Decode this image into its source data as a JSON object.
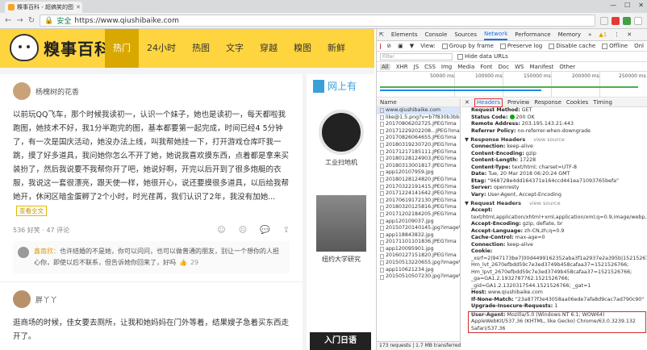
{
  "browser": {
    "tab_title": "糗事百科 - 超搞笑的图",
    "url": "https://www.qiushibaike.com",
    "secure_label": "安全"
  },
  "site": {
    "logo_text": "糗事百科",
    "menu": [
      "热门",
      "24小时",
      "热图",
      "文字",
      "穿越",
      "糗图",
      "新鲜"
    ],
    "posts": [
      {
        "author": "杨槐树的花香",
        "content": "以前玩QQ飞车，那个时候我读初一，认识一个妹子，她也是读初一，每天都啦我跑图，她技术不好，我1分半跑完的图，基本都要第一起完成，时间已经4 5分钟了，有一次是国庆活动，她没办法上线，叫我帮她挂一下，打开游戏仓库吓我一跳，摸了好多道具，我问她你怎么不开了她，她说我喜欢摸东西，点着都是拿来买装扮了，然后我说要不我帮你开了吧，她说好啊，开完以后开到了很多炮艇的衣服，我说这一套很漂亮，跟天使一样，她很开心，说还要摸很多道具，以后给我帮她开，休闲区暗金蛋孵了2个小时，时光荏苒，我们认识了2年，我没有加她...",
        "more_label": "查看全文",
        "stats": "536 好笑 · 47 评论",
        "comment_name": "鑫南欣：",
        "comment_text": "也许结婚的不是她，你可以问问，也可以做普通的朋友，别让一个想你的人担心你，即使以后不联系，但告诉她你回来了，好吗",
        "comment_likes": "29"
      },
      {
        "author": "胖丫丫",
        "content": "逛商场的时候，佳女要去厕所，让我和她妈妈在门外等着，结果嫂子急着买东西走开了。"
      }
    ],
    "sidebar": {
      "title": "网上有",
      "items": [
        "工业扫地机",
        "纽约大学研究"
      ],
      "banner": "入门日语"
    }
  },
  "devtools": {
    "tabs": [
      "Elements",
      "Console",
      "Sources",
      "Network",
      "Performance",
      "Memory"
    ],
    "active_tab": "Network",
    "toolbar": [
      "View:",
      "Group by frame",
      "Preserve log",
      "Disable cache",
      "Offline",
      "Onl"
    ],
    "filter_placeholder": "Filter",
    "hide_data_urls": "Hide data URLs",
    "types": [
      "All",
      "XHR",
      "JS",
      "CSS",
      "Img",
      "Media",
      "Font",
      "Doc",
      "WS",
      "Manifest",
      "Other"
    ],
    "timeline_labels": [
      "50000 ms",
      "100000 ms",
      "150000 ms",
      "200000 ms",
      "250000 ms"
    ],
    "requests_header": "Name",
    "requests": [
      "www.qiushibaike.com",
      "like@1.5.png?v=b7f830b3bb9",
      "20170806202725.JPEG?ima",
      "20171229202208...JPEG?ima",
      "20170826064655.JPEG?ima",
      "20180319230720.JPEG?ima",
      "20171217185111.JPEG?ima",
      "20180128124903.JPEG?ima",
      "20180313001817.JPEG?ima",
      "app120107959.jpg",
      "20180128124820.JPEG?ima",
      "20170322191415.JPEG?ima",
      "20171224141642.JPEG?ima",
      "20170619172130.JPEG?ima",
      "20180320125816.JPEG?ima",
      "20171202184205.JPEG?ima",
      "app120109037.jpg",
      "20150720140145.jpg?imageVi",
      "app118843832.jpg",
      "20171101101836.JPEG?ima",
      "app120095901.jpg",
      "20160127151820.JPEG?ima",
      "20150513220655.jpg?imageVi",
      "app110621234.jpg",
      "20150510507230.jpg?imageVi"
    ],
    "status_bar": "173 requests | 1.7 MB transferred",
    "detail_tabs": [
      "Headers",
      "Preview",
      "Response",
      "Cookies",
      "Timing"
    ],
    "general": [
      [
        "Request Method:",
        "GET"
      ],
      [
        "Status Code:",
        "200 OK"
      ],
      [
        "Remote Address:",
        "203.195.143.21:443"
      ],
      [
        "Referrer Policy:",
        "no-referrer-when-downgrade"
      ]
    ],
    "response_headers_title": "Response Headers",
    "view_source": "view source",
    "response_headers": [
      [
        "Connection:",
        "keep-alive"
      ],
      [
        "Content-Encoding:",
        "gzip"
      ],
      [
        "Content-Length:",
        "17228"
      ],
      [
        "Content-Type:",
        "text/html; charset=UTF-8"
      ],
      [
        "Date:",
        "Tue, 20 Mar 2018 06:20:24 GMT"
      ],
      [
        "Etag:",
        "\"968728e4dd164371e164ccd441ea71093765befa\""
      ],
      [
        "Server:",
        "openresty"
      ],
      [
        "Vary:",
        "User-Agent, Accept-Encoding"
      ]
    ],
    "request_headers_title": "Request Headers",
    "request_headers": [
      [
        "Accept:",
        "text/html,application/xhtml+xml,application/xml;q=0.9,image/webp,image/apng,*/*;q=0.8"
      ],
      [
        "Accept-Encoding:",
        "gzip, deflate, br"
      ],
      [
        "Accept-Language:",
        "zh-CN,zh;q=0.9"
      ],
      [
        "Cache-Control:",
        "max-age=0"
      ],
      [
        "Connection:",
        "keep-alive"
      ],
      [
        "Cookie:",
        "_xsrf=2|947173be7|00d4499162352aba3f1a2937e2a395b|1521526782; Hm_lvt_2670efbdd59c7e3ed3749b458cafaa37=1521526766; Hm_lpvt_2670efbdd59c7e3ed3749b458cafaa37=1521526766; _ga=GA1.2.1932787762.1521526766; _gid=GA1.2.1320317544.1521526766; _gat=1"
      ],
      [
        "Host:",
        "www.qiushibaike.com"
      ],
      [
        "If-None-Match:",
        "\"23a877f3e43058aa06ede7afa8d9cac7ad790c90\""
      ],
      [
        "Upgrade-Insecure-Requests:",
        "1"
      ]
    ],
    "user_agent": [
      "User-Agent:",
      "Mozilla/5.0 (Windows NT 6.1; WOW64) AppleWebKit/537.36 (KHTML, like Gecko) Chrome/63.0.3239.132 Safari/537.36"
    ]
  }
}
